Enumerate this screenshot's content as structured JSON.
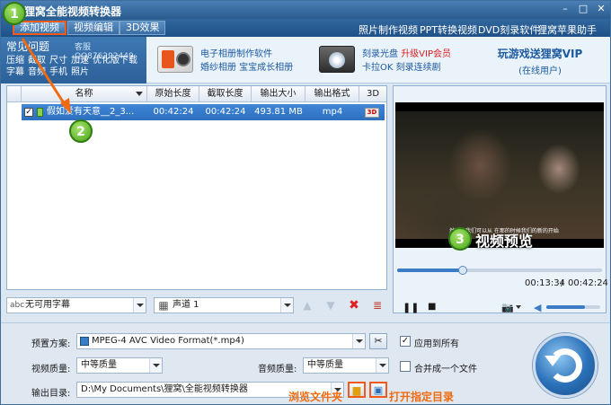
{
  "window": {
    "title": "狸窝全能视频转换器"
  },
  "nav": {
    "tabs": [
      "添加视频",
      "视频编辑",
      "3D效果"
    ],
    "links": [
      "照片制作视频",
      "PPT转换视频",
      "DVD刻录软件",
      "狸窝苹果助手"
    ]
  },
  "faq": {
    "title": "常见问题",
    "qq": "客服QQ876292449",
    "links": [
      "压缩",
      "截取",
      "尺寸",
      "加速",
      "优化版下载",
      "字幕",
      "音频",
      "手机",
      "照片"
    ]
  },
  "promos": [
    {
      "line1": "电子相册制作软件",
      "line2": "婚纱相册  宝宝成长相册"
    },
    {
      "line1": "刻录光盘",
      "line1_red": "升级VIP会员",
      "line2": "卡拉OK  刻录连续剧"
    }
  ],
  "vip": {
    "title": "玩游戏送狸窝VIP",
    "subtitle": "(在线用户)"
  },
  "file_list": {
    "columns": [
      "名称",
      "原始长度",
      "截取长度",
      "输出大小",
      "输出格式",
      "3D"
    ],
    "rows": [
      {
        "name": "假如爱有天意__2_3...",
        "original_length": "00:42:24",
        "cut_length": "00:42:24",
        "output_size": "493.81 MB",
        "format": "mp4",
        "badge_3d": "3D"
      }
    ]
  },
  "list_bar": {
    "subtitle_value": "无可用字幕",
    "audio_value": "声道 1"
  },
  "preview": {
    "subtitle_text": "然而…我们可以从 在那的时候我们的新的开始",
    "elapsed": "00:13:34",
    "total": "00:42:24",
    "progress_fraction": 0.32,
    "volume_fraction": 0.72
  },
  "settings": {
    "preset_label": "预置方案:",
    "preset_value": "MPEG-4 AVC Video Format(*.mp4)",
    "video_quality_label": "视频质量:",
    "video_quality_value": "中等质量",
    "audio_quality_label": "音频质量:",
    "audio_quality_value": "中等质量",
    "output_dir_label": "输出目录:",
    "output_dir_value": "D:\\My Documents\\狸窝\\全能视频转换器",
    "apply_all_label": "应用到所有",
    "merge_label": "合并成一个文件"
  },
  "callouts": {
    "badge1": "1",
    "badge2": "2",
    "badge3": "3",
    "preview_label": "视频预览",
    "browse_folder": "浏览文件夹",
    "open_dir": "打开指定目录"
  },
  "colors": {
    "accent": "#f05a1a",
    "titlebar": "#2a5c8e",
    "selection": "#3377cc"
  }
}
